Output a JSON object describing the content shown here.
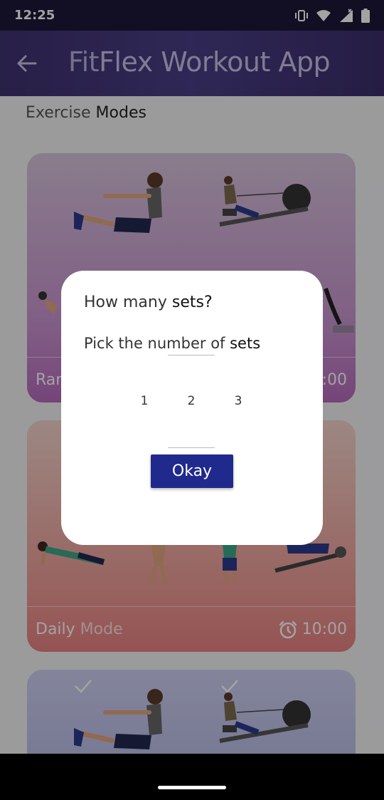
{
  "status_bar": {
    "time": "12:25"
  },
  "app_bar": {
    "title_part1": "Fit",
    "title_part2": "Flex Workout App"
  },
  "section": {
    "title_part1": "Exercise ",
    "title_part2": "Modes"
  },
  "cards": [
    {
      "name_part1": "Ran",
      "name_part2": "",
      "time": ":00",
      "color": "#c993cf"
    },
    {
      "name_part1": "Daily ",
      "name_part2": "Mode",
      "time": "10:00",
      "color": "#e98283"
    },
    {
      "color": "#b9bde8"
    }
  ],
  "dialog": {
    "title_part1": "How many ",
    "title_part2": "sets?",
    "subtitle_part1": "Pick the number of ",
    "subtitle_part2": "sets",
    "picker_options": [
      "1",
      "2",
      "3"
    ],
    "okay_label": "Okay",
    "accent_color": "#1f2a8c"
  }
}
